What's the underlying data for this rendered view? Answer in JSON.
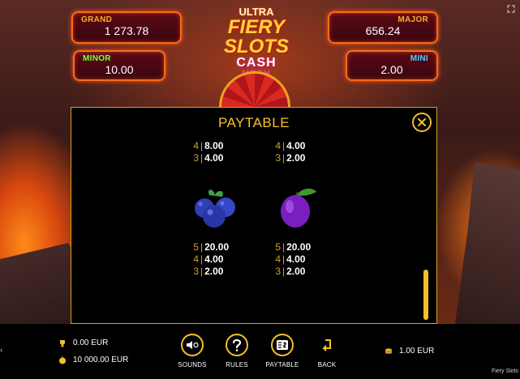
{
  "jackpots": {
    "grand": {
      "label": "GRAND",
      "value": "1 273.78"
    },
    "major": {
      "label": "MAJOR",
      "value": "656.24"
    },
    "minor": {
      "label": "MINOR",
      "value": "10.00"
    },
    "mini": {
      "label": "MINI",
      "value": "2.00"
    }
  },
  "logo": {
    "line1": "ULTRA",
    "line2": "FIERY SLOTS",
    "line3": "CASH",
    "line4": "MESH"
  },
  "paytable": {
    "title": "PAYTABLE",
    "top_left": [
      {
        "n": "4",
        "v": "8.00"
      },
      {
        "n": "3",
        "v": "4.00"
      }
    ],
    "top_right": [
      {
        "n": "4",
        "v": "4.00"
      },
      {
        "n": "3",
        "v": "2.00"
      }
    ],
    "symbols": [
      {
        "icon": "blueberries-icon",
        "pays": [
          {
            "n": "5",
            "v": "20.00"
          },
          {
            "n": "4",
            "v": "4.00"
          },
          {
            "n": "3",
            "v": "2.00"
          }
        ]
      },
      {
        "icon": "plum-icon",
        "pays": [
          {
            "n": "5",
            "v": "20.00"
          },
          {
            "n": "4",
            "v": "4.00"
          },
          {
            "n": "3",
            "v": "2.00"
          }
        ]
      }
    ]
  },
  "footer": {
    "win": "0.00 EUR",
    "balance": "10 000.00 EUR",
    "bet": "1.00 EUR",
    "buttons": {
      "sounds": "SOUNDS",
      "rules": "RULES",
      "paytable": "PAYTABLE",
      "back": "BACK"
    },
    "brand": "Fiery Slots"
  },
  "colors": {
    "accent": "#f5c02a",
    "panel_bg": "#000000",
    "jackpot_border": "#ff6a1a"
  }
}
